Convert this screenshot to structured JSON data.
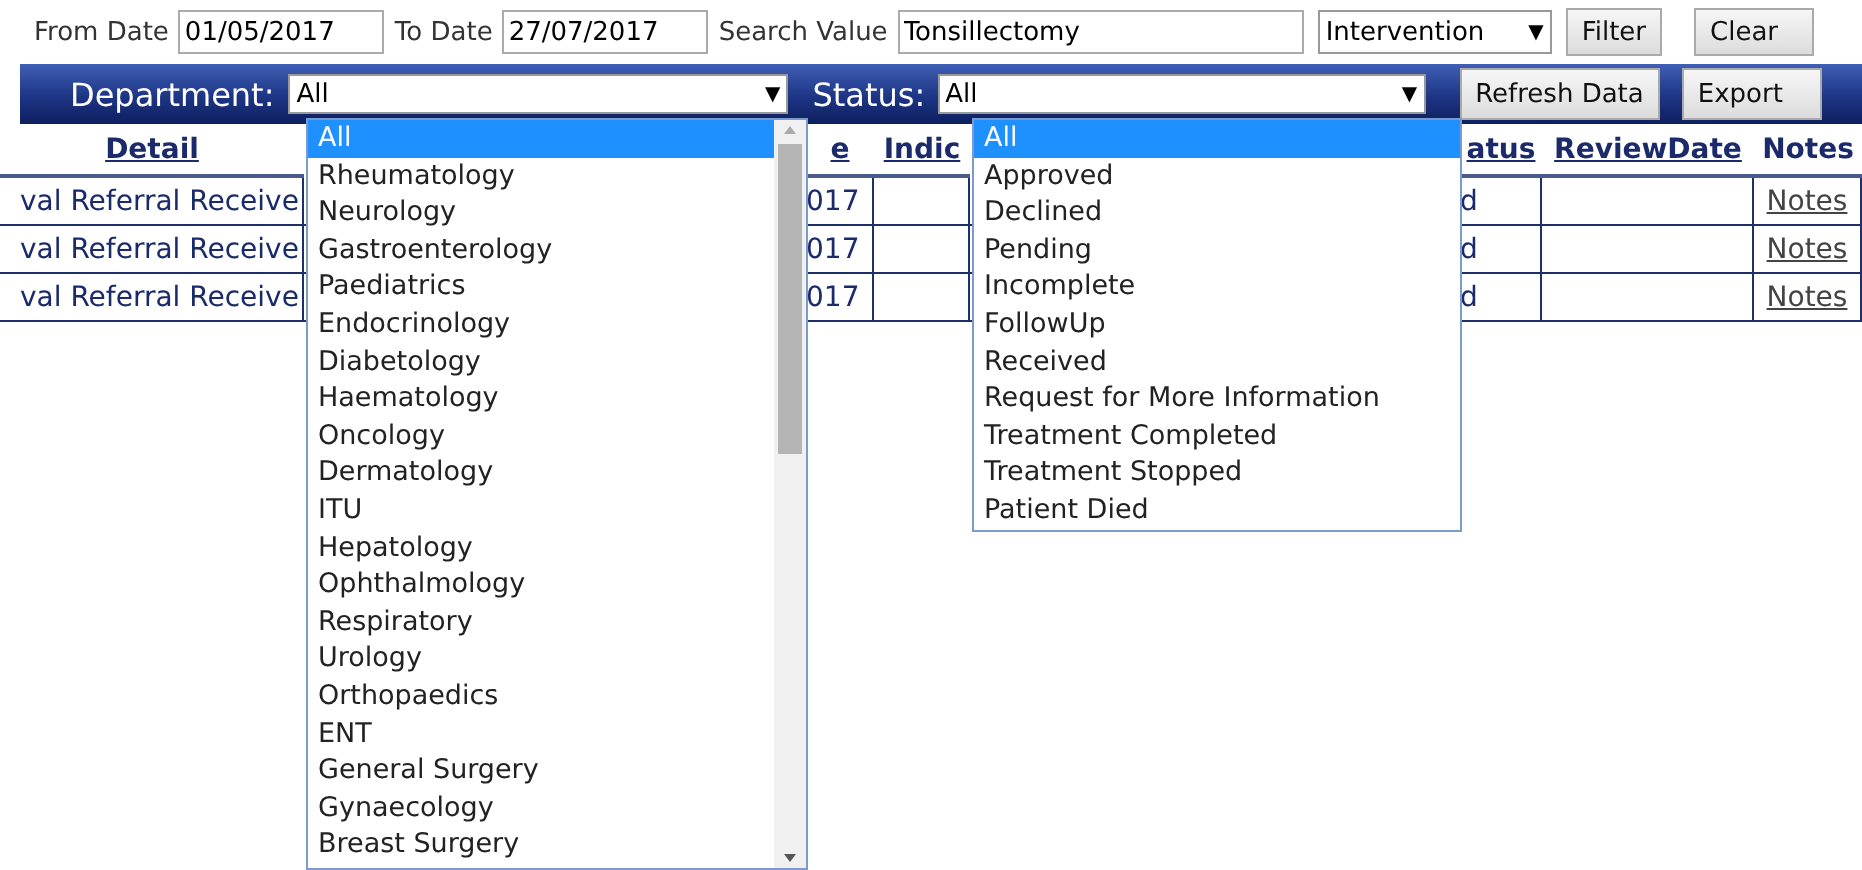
{
  "filters": {
    "from_date": {
      "label": "From Date",
      "value": "01/05/2017"
    },
    "to_date": {
      "label": "To Date",
      "value": "27/07/2017"
    },
    "search": {
      "label": "Search Value",
      "value": "Tonsillectomy"
    },
    "search_type": {
      "value": "Intervention",
      "arrow": "▼"
    },
    "buttons": [
      "Filter",
      "Clear"
    ]
  },
  "toolbar": {
    "department": {
      "label": "Department:",
      "value": "All",
      "arrow": "▼"
    },
    "status": {
      "label": "Status:",
      "value": "All",
      "arrow": "▼"
    },
    "buttons": [
      "Refresh Data",
      "Export"
    ]
  },
  "table": {
    "columns": [
      {
        "label": "Detail",
        "link": true
      },
      {
        "label": "e",
        "link": true
      },
      {
        "label": "Indic",
        "link": true
      },
      {
        "label": "atus",
        "link": true
      },
      {
        "label": "ReviewDate",
        "link": true
      },
      {
        "label": "Notes",
        "link": false
      }
    ],
    "rows": [
      {
        "detail": "val Referral Receive",
        "column_2": "017",
        "status": "d",
        "notes": "Notes"
      },
      {
        "detail": "val Referral Receive",
        "column_2": "017",
        "status": "d",
        "notes": "Notes"
      },
      {
        "detail": "val Referral Receive",
        "column_2": "017",
        "status": "d",
        "notes": "Notes"
      }
    ]
  },
  "department_options": [
    {
      "label": "All",
      "selected": true
    },
    {
      "label": "Rheumatology",
      "selected": false
    },
    {
      "label": "Neurology",
      "selected": false
    },
    {
      "label": "Gastroenterology",
      "selected": false
    },
    {
      "label": "Paediatrics",
      "selected": false
    },
    {
      "label": "Endocrinology",
      "selected": false
    },
    {
      "label": "Diabetology",
      "selected": false
    },
    {
      "label": "Haematology",
      "selected": false
    },
    {
      "label": "Oncology",
      "selected": false
    },
    {
      "label": "Dermatology",
      "selected": false
    },
    {
      "label": "ITU",
      "selected": false
    },
    {
      "label": "Hepatology",
      "selected": false
    },
    {
      "label": "Ophthalmology",
      "selected": false
    },
    {
      "label": "Respiratory",
      "selected": false
    },
    {
      "label": "Urology",
      "selected": false
    },
    {
      "label": "Orthopaedics",
      "selected": false
    },
    {
      "label": "ENT",
      "selected": false
    },
    {
      "label": "General Surgery",
      "selected": false
    },
    {
      "label": "Gynaecology",
      "selected": false
    },
    {
      "label": "Breast Surgery",
      "selected": false
    }
  ],
  "status_options": [
    {
      "label": "All",
      "selected": true
    },
    {
      "label": "Approved",
      "selected": false
    },
    {
      "label": "Declined",
      "selected": false
    },
    {
      "label": "Pending",
      "selected": false
    },
    {
      "label": "Incomplete",
      "selected": false
    },
    {
      "label": "FollowUp",
      "selected": false
    },
    {
      "label": "Received",
      "selected": false
    },
    {
      "label": "Request for More Information",
      "selected": false
    },
    {
      "label": "Treatment Completed",
      "selected": false
    },
    {
      "label": "Treatment Stopped",
      "selected": false
    },
    {
      "label": "Patient Died",
      "selected": false
    }
  ]
}
